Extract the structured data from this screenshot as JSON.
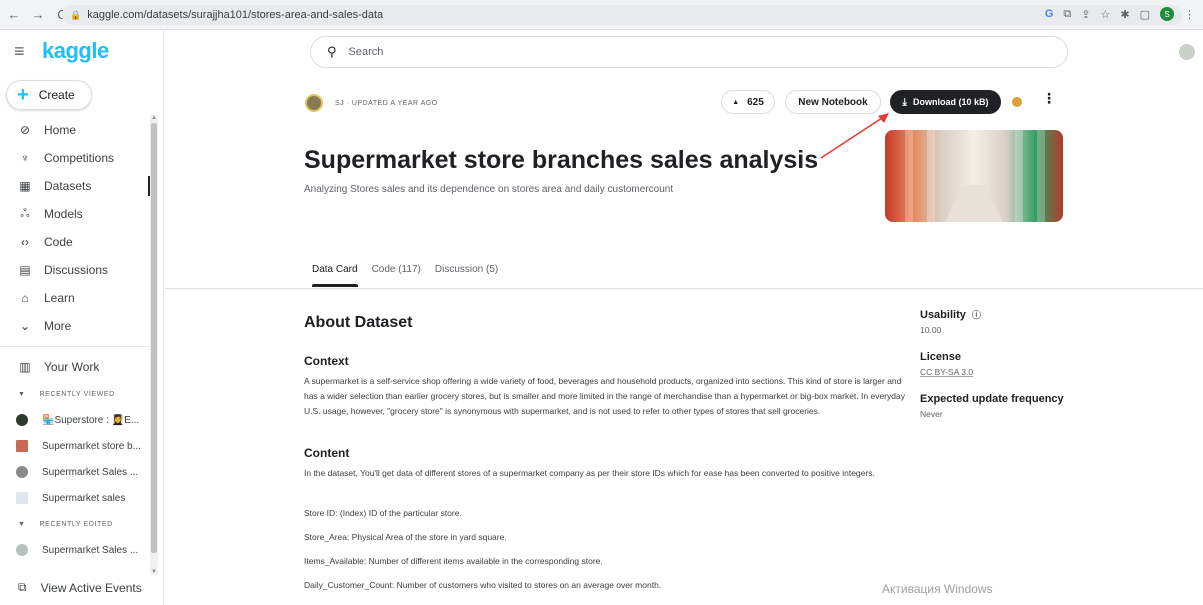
{
  "browser": {
    "url": "kaggle.com/datasets/surajjha101/stores-area-and-sales-data",
    "profile_initial": "S"
  },
  "sidebar": {
    "logo": "kaggle",
    "create_label": "Create",
    "nav": [
      {
        "label": "Home",
        "icon": "compass-icon"
      },
      {
        "label": "Competitions",
        "icon": "trophy-icon"
      },
      {
        "label": "Datasets",
        "icon": "table-icon"
      },
      {
        "label": "Models",
        "icon": "models-icon"
      },
      {
        "label": "Code",
        "icon": "code-icon"
      },
      {
        "label": "Discussions",
        "icon": "discussion-icon"
      },
      {
        "label": "Learn",
        "icon": "graduation-cap-icon"
      },
      {
        "label": "More",
        "icon": "chevron-down-icon"
      }
    ],
    "your_work": "Your Work",
    "recently_viewed_label": "RECENTLY VIEWED",
    "recently_viewed": [
      "🏪Superstore : 👩‍🎓E...",
      "Supermarket store b...",
      "Supermarket Sales ...",
      "Supermarket sales"
    ],
    "recently_edited_label": "RECENTLY EDITED",
    "recently_edited": [
      "Supermarket Sales ..."
    ],
    "view_active_events": "View Active Events"
  },
  "header": {
    "search_placeholder": "Search"
  },
  "dataset": {
    "meta": "SJ · UPDATED A YEAR AGO",
    "upvotes": "625",
    "new_notebook": "New Notebook",
    "download": "Download (10 kB)",
    "title": "Supermarket store branches sales analysis",
    "subtitle": "Analyzing Stores sales and its dependence on stores area and daily customercount"
  },
  "tabs": [
    "Data Card",
    "Code (117)",
    "Discussion (5)"
  ],
  "about": {
    "heading": "About Dataset",
    "context_heading": "Context",
    "context_text": "A supermarket is a self-service shop offering a wide variety of food, beverages and household products, organized into sections. This kind of store is larger and has a wider selection than earlier grocery stores, but is smaller and more limited in the range of merchandise than a hypermarket or big-box market. In everyday U.S. usage, however, \"grocery store\" is synonymous with supermarket, and is not used to refer to other types of stores that sell groceries.",
    "content_heading": "Content",
    "content_text": "In the dataset, You'll get data of different stores of a supermarket company as per their store IDs which for ease has been converted to positive integers.",
    "store_id": "Store ID: (Index) ID of the particular store.",
    "store_area": "Store_Area: Physical Area of the store in yard square.",
    "items_available": "Items_Available: Number of different items available in the corresponding store.",
    "daily_customer": "Daily_Customer_Count: Number of customers who visited to stores on an average over month."
  },
  "side_panel": {
    "usability_label": "Usability",
    "usability_value": "10.00",
    "license_label": "License",
    "license_value": "CC BY-SA 3.0",
    "update_label": "Expected update frequency",
    "update_value": "Never"
  },
  "watermark": "Активация Windows",
  "colors": {
    "brand": "#20beff",
    "dark_button": "#202124",
    "annotation_arrow": "#e53935"
  }
}
